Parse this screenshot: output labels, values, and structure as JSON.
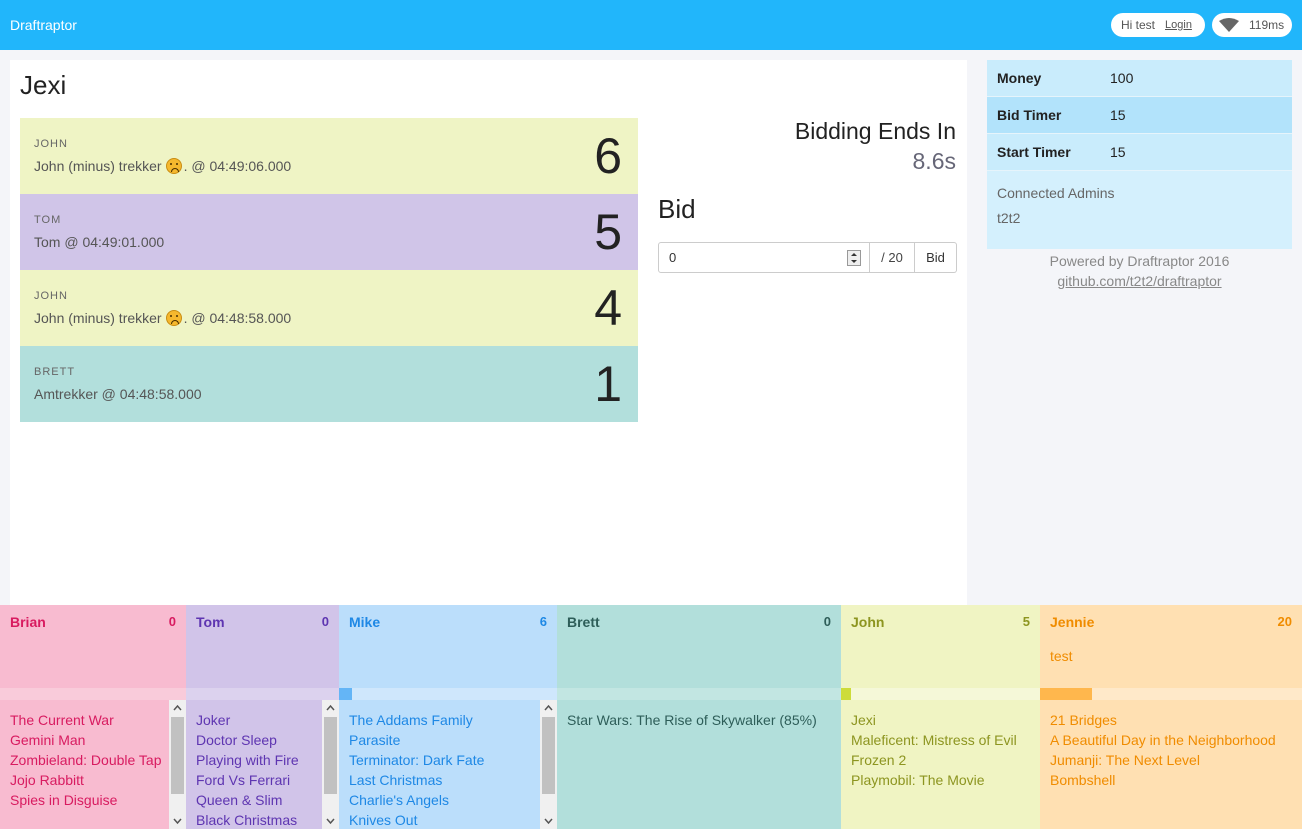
{
  "header": {
    "brand": "Draftraptor",
    "greeting": "Hi test",
    "login": "Login",
    "ping": "119ms"
  },
  "auction": {
    "title": "Jexi",
    "timer_label": "Bidding Ends In",
    "timer_value": "8.6s",
    "bid_title": "Bid",
    "bid_input_value": "0",
    "bid_max": "/ 20",
    "bid_button": "Bid",
    "bids": [
      {
        "name": "John",
        "desc_pre": "John (minus) trekker",
        "emoji": true,
        "desc_post": ". @ 04:49:06.000",
        "amount": "6",
        "color": "#eff4c5"
      },
      {
        "name": "Tom",
        "desc_pre": "Tom @ 04:49:01.000",
        "emoji": false,
        "desc_post": "",
        "amount": "5",
        "color": "#d0c5e8"
      },
      {
        "name": "John",
        "desc_pre": "John (minus) trekker",
        "emoji": true,
        "desc_post": ". @ 04:48:58.000",
        "amount": "4",
        "color": "#eff4c5"
      },
      {
        "name": "Brett",
        "desc_pre": "Amtrekker @ 04:48:58.000",
        "emoji": false,
        "desc_post": "",
        "amount": "1",
        "color": "#b2dfdc"
      }
    ]
  },
  "settings": {
    "rows": [
      {
        "key": "Money",
        "value": "100"
      },
      {
        "key": "Bid Timer",
        "value": "15"
      },
      {
        "key": "Start Timer",
        "value": "15"
      }
    ],
    "admins_label": "Connected Admins",
    "admins": "t2t2",
    "powered": "Powered by Draftraptor 2016",
    "repo": "github.com/t2t2/draftraptor"
  },
  "teams": [
    {
      "name": "Brian",
      "score": "0",
      "note": "",
      "bg": "#f8bbd0",
      "bar_bg": "#f9cbda",
      "bar_fill": 0,
      "bar_color": "#ec407a",
      "text": "#d81b60",
      "scroll": true,
      "picks": [
        "The Current War",
        "Gemini Man",
        "Zombieland: Double Tap",
        "Jojo Rabbitt",
        "Spies in Disguise"
      ]
    },
    {
      "name": "Tom",
      "score": "0",
      "note": "",
      "bg": "#d1c4e9",
      "bar_bg": "#dcd2ee",
      "bar_fill": 0,
      "bar_color": "#7e57c2",
      "text": "#5e35b1",
      "scroll": true,
      "picks": [
        "Joker",
        "Doctor Sleep",
        "Playing with Fire",
        "Ford Vs Ferrari",
        "Queen & Slim",
        "Black Christmas"
      ]
    },
    {
      "name": "Mike",
      "score": "6",
      "note": "",
      "bg": "#bbdefb",
      "bar_bg": "#cfe7fc",
      "bar_fill": 0.06,
      "bar_color": "#64b5f6",
      "text": "#1e88e5",
      "scroll": true,
      "picks": [
        "The Addams Family",
        "Parasite",
        "Terminator: Dark Fate",
        "Last Christmas",
        "Charlie's Angels",
        "Knives Out"
      ]
    },
    {
      "name": "Brett",
      "score": "0",
      "note": "",
      "bg": "#b2dfdb",
      "bar_bg": "#c2e6e2",
      "bar_fill": 0,
      "bar_color": "#26a69a",
      "text": "#2e5e59",
      "scroll": false,
      "picks": [
        "Star Wars: The Rise of Skywalker (85%)"
      ]
    },
    {
      "name": "John",
      "score": "5",
      "note": "",
      "bg": "#f0f4c3",
      "bar_bg": "#f5f8d8",
      "bar_fill": 0.05,
      "bar_color": "#cddc39",
      "text": "#8d9520",
      "scroll": false,
      "picks": [
        "Jexi",
        "Maleficent: Mistress of Evil",
        "Frozen 2",
        "Playmobil: The Movie"
      ]
    },
    {
      "name": "Jennie",
      "score": "20",
      "note": "test",
      "bg": "#ffe0b2",
      "bar_bg": "#ffe9c9",
      "bar_fill": 0.2,
      "bar_color": "#ffb74d",
      "text": "#f08c00",
      "scroll": false,
      "picks": [
        "21 Bridges",
        "A Beautiful Day in the Neighborhood",
        "Jumanji: The Next Level",
        "Bombshell"
      ]
    }
  ]
}
